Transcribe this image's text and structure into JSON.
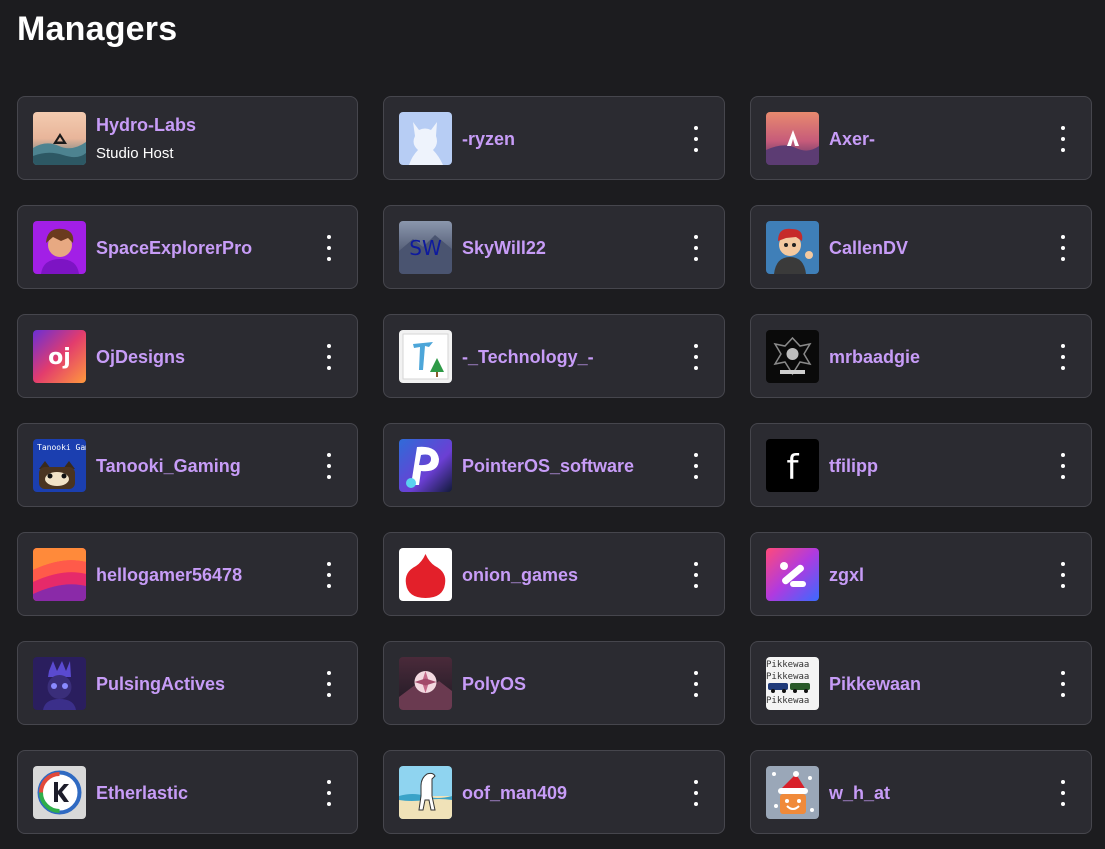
{
  "page": {
    "title": "Managers"
  },
  "managers": [
    {
      "name": "Hydro-Labs",
      "role": "Studio Host",
      "avatar": "hydro-labs-avatar",
      "has_menu": false
    },
    {
      "name": "-ryzen",
      "avatar": "ryzen-avatar",
      "has_menu": true
    },
    {
      "name": "Axer-",
      "avatar": "axer-avatar",
      "has_menu": true
    },
    {
      "name": "SpaceExplorerPro",
      "avatar": "spaceexplorerpro-avatar",
      "has_menu": true
    },
    {
      "name": "SkyWill22",
      "avatar": "skywill22-avatar",
      "avatar_text": "SW",
      "has_menu": true
    },
    {
      "name": "CallenDV",
      "avatar": "callendv-avatar",
      "has_menu": true
    },
    {
      "name": "OjDesigns",
      "avatar": "ojdesigns-avatar",
      "avatar_text": "oj",
      "has_menu": true
    },
    {
      "name": "-_Technology_-",
      "avatar": "technology-avatar",
      "has_menu": true
    },
    {
      "name": "mrbaadgie",
      "avatar": "mrbaadgie-avatar",
      "has_menu": true
    },
    {
      "name": "Tanooki_Gaming",
      "avatar": "tanooki-gaming-avatar",
      "avatar_text": "Tanooki Gaming",
      "has_menu": true
    },
    {
      "name": "PointerOS_software",
      "avatar": "pointeros-avatar",
      "has_menu": true
    },
    {
      "name": "tfilipp",
      "avatar": "tfilipp-avatar",
      "avatar_text": "f",
      "has_menu": true
    },
    {
      "name": "hellogamer56478",
      "avatar": "hellogamer-avatar",
      "has_menu": true
    },
    {
      "name": "onion_games",
      "avatar": "onion-games-avatar",
      "has_menu": true
    },
    {
      "name": "zgxl",
      "avatar": "zgxl-avatar",
      "has_menu": true
    },
    {
      "name": "PulsingActives",
      "avatar": "pulsingactives-avatar",
      "has_menu": true
    },
    {
      "name": "PolyOS",
      "avatar": "polyos-avatar",
      "has_menu": true
    },
    {
      "name": "Pikkewaan",
      "avatar": "pikkewaan-avatar",
      "avatar_text": "Pikkewaa",
      "has_menu": true
    },
    {
      "name": "Etherlastic",
      "avatar": "etherlastic-avatar",
      "has_menu": true
    },
    {
      "name": "oof_man409",
      "avatar": "oof-man409-avatar",
      "has_menu": true
    },
    {
      "name": "w_h_at",
      "avatar": "w-h-at-avatar",
      "has_menu": true
    }
  ],
  "colors": {
    "background": "#1c1c1f",
    "card": "#2b2b31",
    "card_border": "#46464d",
    "username": "#c79cf7",
    "text": "#ffffff"
  }
}
